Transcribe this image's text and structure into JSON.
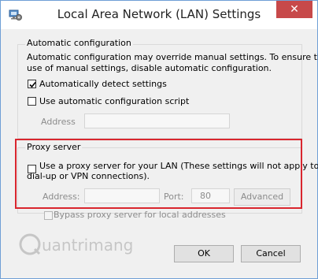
{
  "window": {
    "title": "Local Area Network (LAN) Settings",
    "close_glyph": "✕",
    "accent_close": "#c7494a",
    "highlight_color": "#d9262e"
  },
  "auto": {
    "group_label": "Automatic configuration",
    "description_line1": "Automatic configuration may override manual settings.  To ensure the",
    "description_line2": "use of manual settings, disable automatic configuration.",
    "detect_label": "Automatically detect settings",
    "detect_checked": true,
    "script_label": "Use automatic configuration script",
    "script_checked": false,
    "address_label": "Address",
    "address_value": ""
  },
  "proxy": {
    "group_label": "Proxy server",
    "use_proxy_line1": "Use a proxy server for your LAN (These settings will not apply to",
    "use_proxy_line2": "dial-up or VPN connections).",
    "use_proxy_checked": false,
    "address_label": "Address:",
    "address_value": "",
    "port_label": "Port:",
    "port_value": "80",
    "advanced_label": "Advanced",
    "bypass_label": "Bypass proxy server for local addresses",
    "bypass_checked": false
  },
  "watermark": {
    "text": "uantrimang"
  },
  "buttons": {
    "ok_label": "OK",
    "cancel_label": "Cancel"
  }
}
